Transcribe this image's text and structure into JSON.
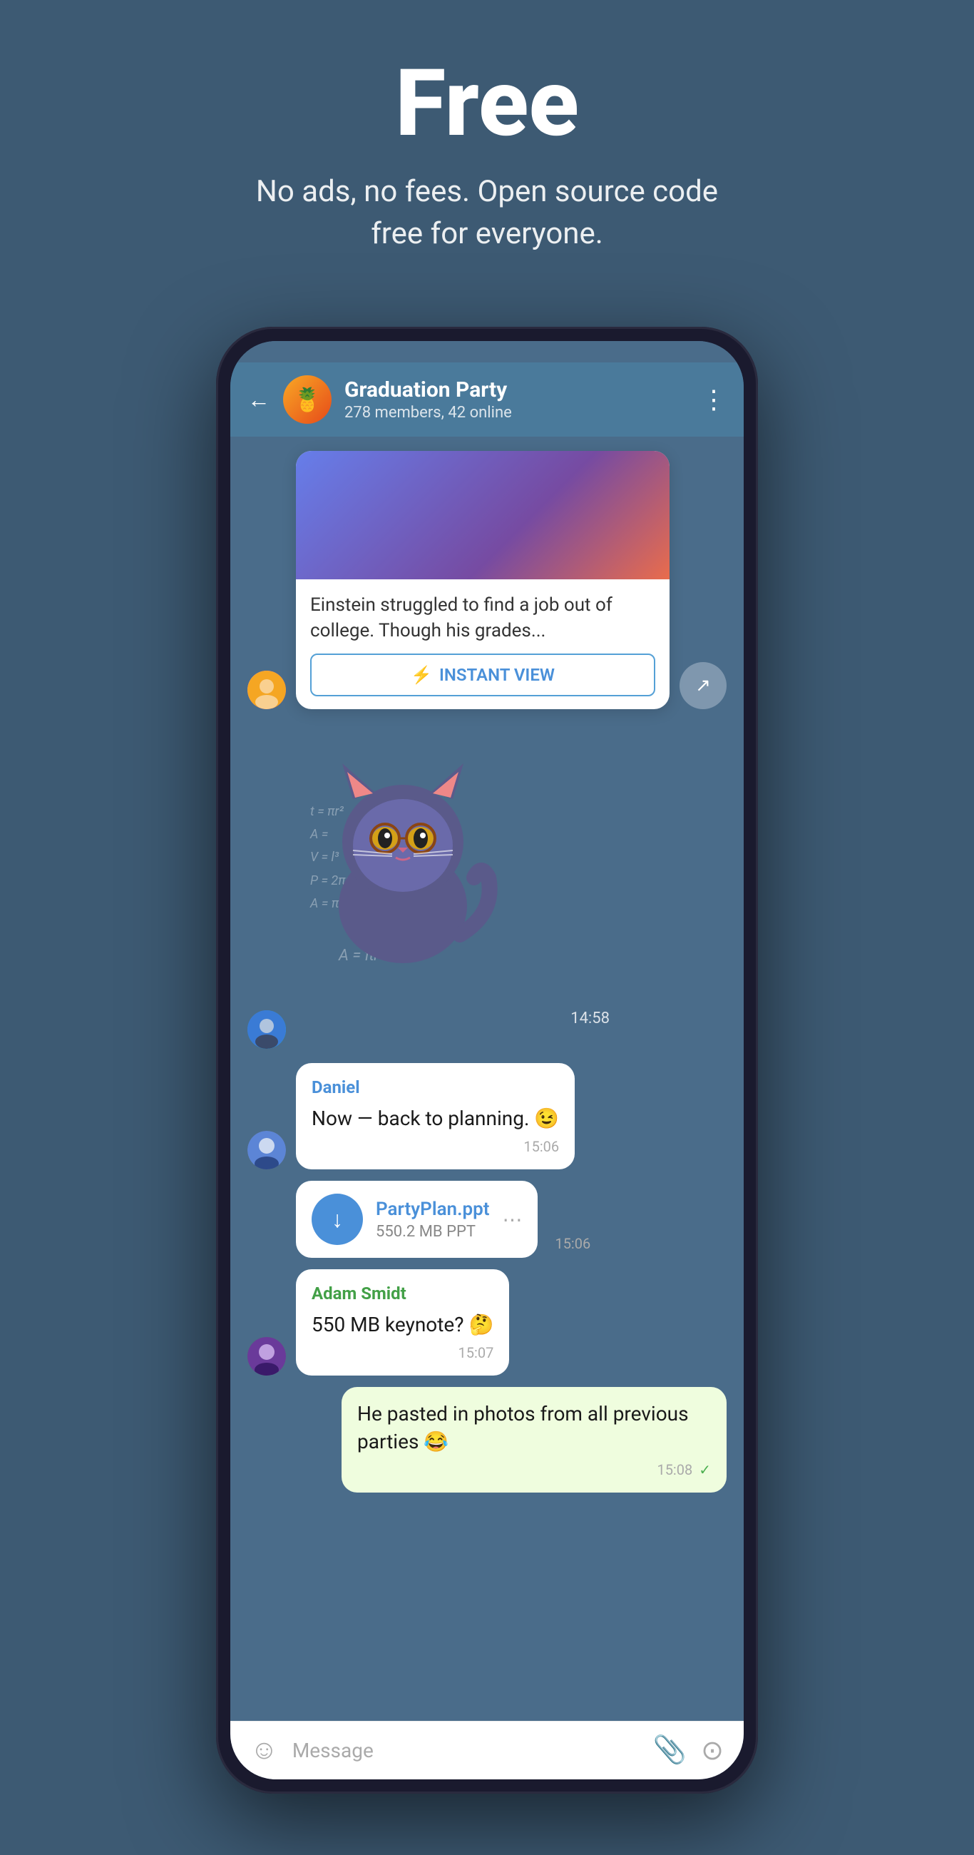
{
  "hero": {
    "title": "Free",
    "subtitle": "No ads, no fees. Open source code free for everyone."
  },
  "chat": {
    "back_label": "←",
    "name": "Graduation Party",
    "meta": "278 members, 42 online",
    "more_label": "⋮"
  },
  "messages": [
    {
      "id": "iv-card",
      "type": "instant_view",
      "text": "Einstein struggled to find a job out of college. Though his grades...",
      "iv_button": "INSTANT VIEW",
      "time": ""
    },
    {
      "id": "sticker",
      "type": "sticker",
      "time": "14:58"
    },
    {
      "id": "daniel-msg",
      "type": "text",
      "sender": "Daniel",
      "sender_color": "blue",
      "text": "Now — back to planning. 😉",
      "time": "15:06"
    },
    {
      "id": "file-msg",
      "type": "file",
      "file_name": "PartyPlan.ppt",
      "file_size": "550.2 MB PPT",
      "time": "15:06"
    },
    {
      "id": "adam-msg",
      "type": "text",
      "sender": "Adam Smidt",
      "sender_color": "green",
      "text": "550 MB keynote? 🤔",
      "time": "15:07"
    },
    {
      "id": "own-msg",
      "type": "own",
      "text": "He pasted in photos from all previous parties 😂",
      "time": "15:08",
      "checkmark": "✓"
    }
  ],
  "bottom_bar": {
    "emoji_label": "☺",
    "placeholder": "Message",
    "attach_label": "📎",
    "camera_label": "⊙"
  },
  "icons": {
    "lightning": "⚡",
    "download": "↓",
    "share": "↗"
  }
}
